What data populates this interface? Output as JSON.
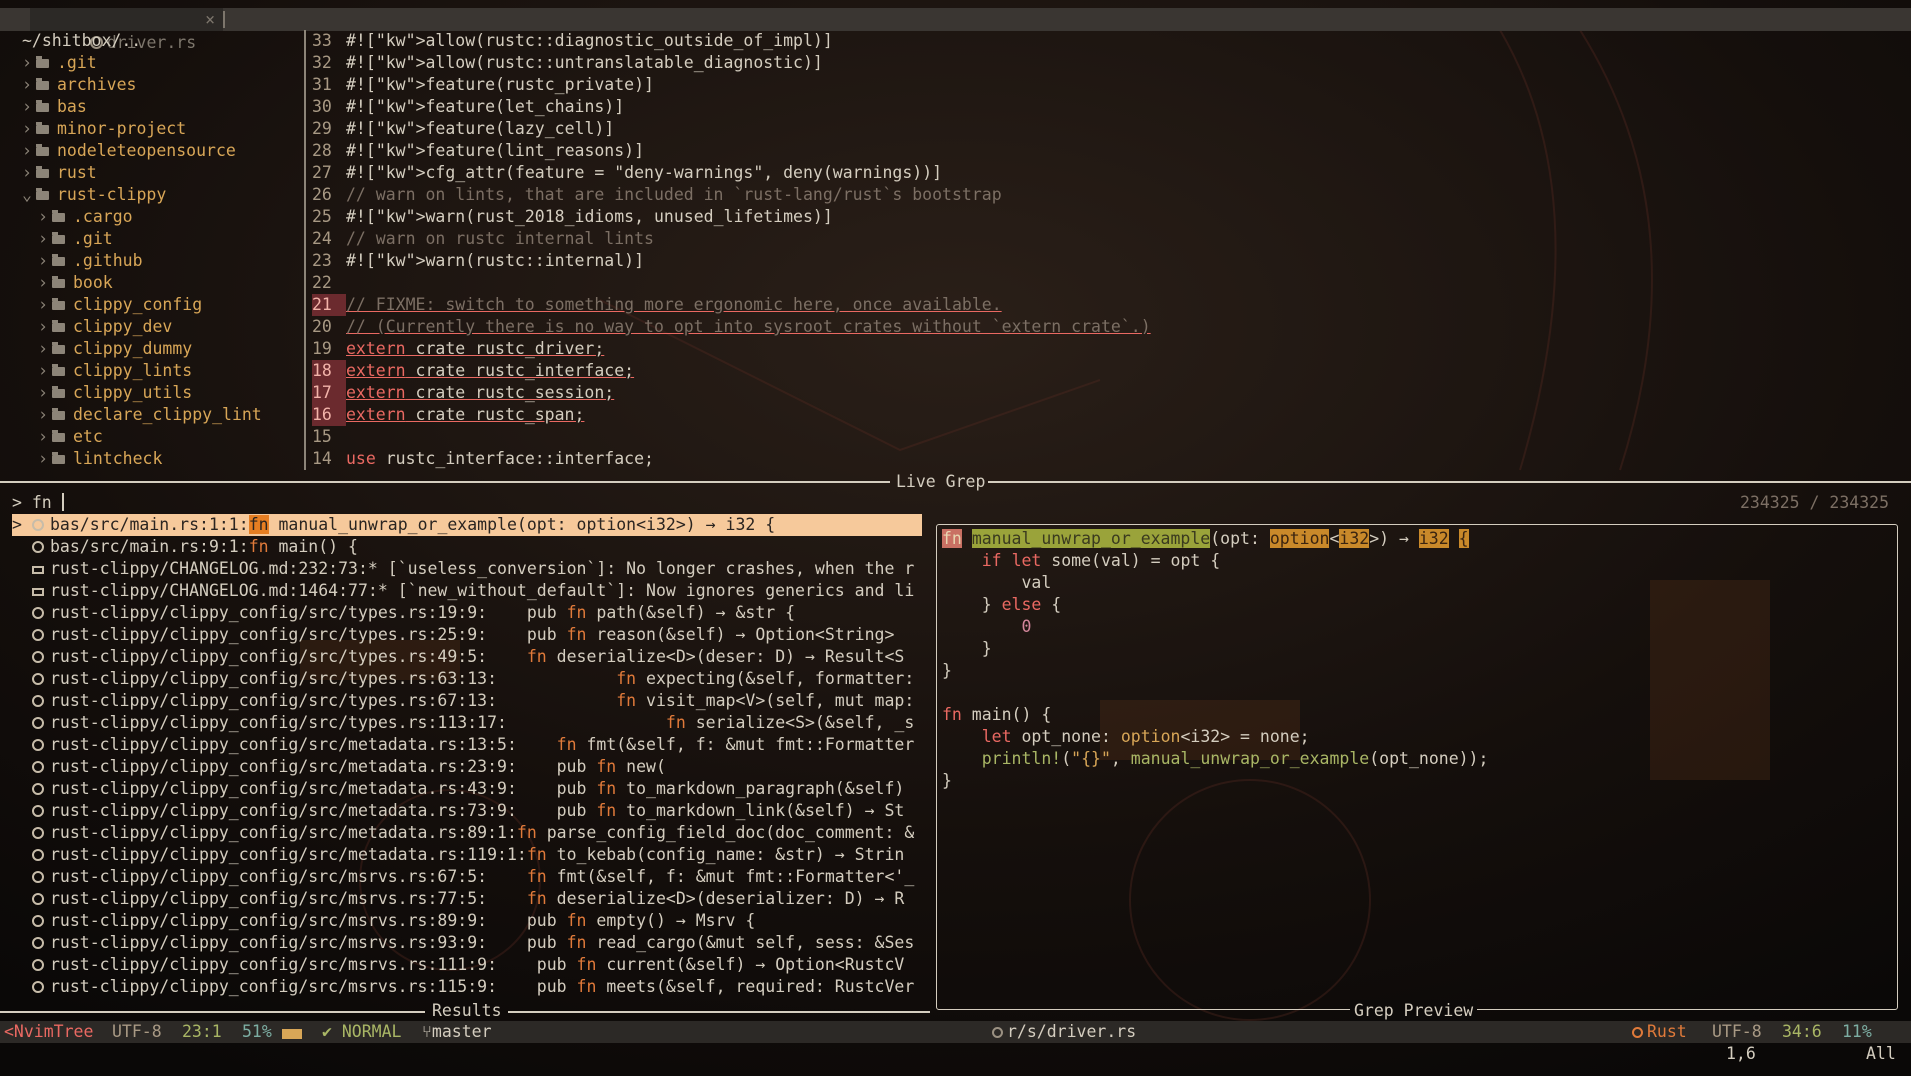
{
  "tab": {
    "filename": "driver.rs",
    "close": "×"
  },
  "tree": {
    "root": "~/shitbox/..",
    "items": [
      {
        "label": ".git",
        "depth": 1,
        "open": false
      },
      {
        "label": "archives",
        "depth": 1,
        "open": false
      },
      {
        "label": "bas",
        "depth": 1,
        "open": false
      },
      {
        "label": "minor-project",
        "depth": 1,
        "open": false
      },
      {
        "label": "nodeleteopensource",
        "depth": 1,
        "open": false
      },
      {
        "label": "rust",
        "depth": 1,
        "open": false
      },
      {
        "label": "rust-clippy",
        "depth": 1,
        "open": true
      },
      {
        "label": ".cargo",
        "depth": 2,
        "open": false
      },
      {
        "label": ".git",
        "depth": 2,
        "open": false
      },
      {
        "label": ".github",
        "depth": 2,
        "open": false
      },
      {
        "label": "book",
        "depth": 2,
        "open": false
      },
      {
        "label": "clippy_config",
        "depth": 2,
        "open": false
      },
      {
        "label": "clippy_dev",
        "depth": 2,
        "open": false
      },
      {
        "label": "clippy_dummy",
        "depth": 2,
        "open": false
      },
      {
        "label": "clippy_lints",
        "depth": 2,
        "open": false
      },
      {
        "label": "clippy_utils",
        "depth": 2,
        "open": false
      },
      {
        "label": "declare_clippy_lint",
        "depth": 2,
        "open": false
      },
      {
        "label": "etc",
        "depth": 2,
        "open": false
      },
      {
        "label": "lintcheck",
        "depth": 2,
        "open": false
      }
    ]
  },
  "code": [
    {
      "ln": "33",
      "text": "#![allow(rustc::diagnostic_outside_of_impl)]"
    },
    {
      "ln": "32",
      "text": "#![allow(rustc::untranslatable_diagnostic)]"
    },
    {
      "ln": "31",
      "text": "#![feature(rustc_private)]"
    },
    {
      "ln": "30",
      "text": "#![feature(let_chains)]"
    },
    {
      "ln": "29",
      "text": "#![feature(lazy_cell)]"
    },
    {
      "ln": "28",
      "text": "#![feature(lint_reasons)]"
    },
    {
      "ln": "27",
      "text": "#![cfg_attr(feature = \"deny-warnings\", deny(warnings))]"
    },
    {
      "ln": "26",
      "text": "// warn on lints, that are included in `rust-lang/rust`s bootstrap"
    },
    {
      "ln": "25",
      "text": "#![warn(rust_2018_idioms, unused_lifetimes)]"
    },
    {
      "ln": "24",
      "text": "// warn on rustc internal lints"
    },
    {
      "ln": "23",
      "text": "#![warn(rustc::internal)]"
    },
    {
      "ln": "22",
      "text": ""
    },
    {
      "ln": "21",
      "text": "// FIXME: switch to something more ergonomic here, once available."
    },
    {
      "ln": "20",
      "text": "// (Currently there is no way to opt into sysroot crates without `extern crate`.)"
    },
    {
      "ln": "19",
      "text": "extern crate rustc_driver;"
    },
    {
      "ln": "18",
      "text": "extern crate rustc_interface;"
    },
    {
      "ln": "17",
      "text": "extern crate rustc_session;"
    },
    {
      "ln": "16",
      "text": "extern crate rustc_span;"
    },
    {
      "ln": "15",
      "text": ""
    },
    {
      "ln": "14",
      "text": "use rustc_interface::interface;"
    }
  ],
  "grep": {
    "title": "Live Grep",
    "prompt": "> fn ",
    "count": "234325 / 234325",
    "results_label": "Results",
    "preview_label": "Grep Preview",
    "results": [
      {
        "icon": "rust",
        "path": "bas/src/main.rs:1:1:",
        "pre": "",
        "kw": "fn",
        "post": " manual_unwrap_or_example(opt: option<i32>) → i32 {",
        "selected": true
      },
      {
        "icon": "rust",
        "path": "bas/src/main.rs:9:1:",
        "pre": "",
        "kw": "fn",
        "post": " main() {"
      },
      {
        "icon": "md",
        "path": "rust-clippy/CHANGELOG.md:232:73:",
        "pre": "* [`useless_conversion`]: No longer crashes, when the r",
        "kw": "",
        "post": ""
      },
      {
        "icon": "md",
        "path": "rust-clippy/CHANGELOG.md:1464:77:",
        "pre": "* [`new_without_default`]: Now ignores generics and li",
        "kw": "",
        "post": ""
      },
      {
        "icon": "rust",
        "path": "rust-clippy/clippy_config/src/types.rs:19:9:",
        "pre": "    pub ",
        "kw": "fn",
        "post": " path(&self) → &str {"
      },
      {
        "icon": "rust",
        "path": "rust-clippy/clippy_config/src/types.rs:25:9:",
        "pre": "    pub ",
        "kw": "fn",
        "post": " reason(&self) → Option<String>"
      },
      {
        "icon": "rust",
        "path": "rust-clippy/clippy_config/src/types.rs:49:5:",
        "pre": "    ",
        "kw": "fn",
        "post": " deserialize<D>(deser: D) → Result<S"
      },
      {
        "icon": "rust",
        "path": "rust-clippy/clippy_config/src/types.rs:63:13:",
        "pre": "            ",
        "kw": "fn",
        "post": " expecting(&self, formatter:"
      },
      {
        "icon": "rust",
        "path": "rust-clippy/clippy_config/src/types.rs:67:13:",
        "pre": "            ",
        "kw": "fn",
        "post": " visit_map<V>(self, mut map:"
      },
      {
        "icon": "rust",
        "path": "rust-clippy/clippy_config/src/types.rs:113:17:",
        "pre": "                ",
        "kw": "fn",
        "post": " serialize<S>(&self, _s"
      },
      {
        "icon": "rust",
        "path": "rust-clippy/clippy_config/src/metadata.rs:13:5:",
        "pre": "    ",
        "kw": "fn",
        "post": " fmt(&self, f: &mut fmt::Formatter"
      },
      {
        "icon": "rust",
        "path": "rust-clippy/clippy_config/src/metadata.rs:23:9:",
        "pre": "    pub ",
        "kw": "fn",
        "post": " new("
      },
      {
        "icon": "rust",
        "path": "rust-clippy/clippy_config/src/metadata.rs:43:9:",
        "pre": "    pub ",
        "kw": "fn",
        "post": " to_markdown_paragraph(&self)"
      },
      {
        "icon": "rust",
        "path": "rust-clippy/clippy_config/src/metadata.rs:73:9:",
        "pre": "    pub ",
        "kw": "fn",
        "post": " to_markdown_link(&self) → St"
      },
      {
        "icon": "rust",
        "path": "rust-clippy/clippy_config/src/metadata.rs:89:1:",
        "pre": "",
        "kw": "fn",
        "post": " parse_config_field_doc(doc_comment: &"
      },
      {
        "icon": "rust",
        "path": "rust-clippy/clippy_config/src/metadata.rs:119:1:",
        "pre": "",
        "kw": "fn",
        "post": " to_kebab(config_name: &str) → Strin"
      },
      {
        "icon": "rust",
        "path": "rust-clippy/clippy_config/src/msrvs.rs:67:5:",
        "pre": "    ",
        "kw": "fn",
        "post": " fmt(&self, f: &mut fmt::Formatter<'_"
      },
      {
        "icon": "rust",
        "path": "rust-clippy/clippy_config/src/msrvs.rs:77:5:",
        "pre": "    ",
        "kw": "fn",
        "post": " deserialize<D>(deserializer: D) → R"
      },
      {
        "icon": "rust",
        "path": "rust-clippy/clippy_config/src/msrvs.rs:89:9:",
        "pre": "    pub ",
        "kw": "fn",
        "post": " empty() → Msrv {"
      },
      {
        "icon": "rust",
        "path": "rust-clippy/clippy_config/src/msrvs.rs:93:9:",
        "pre": "    pub ",
        "kw": "fn",
        "post": " read_cargo(&mut self, sess: &Ses"
      },
      {
        "icon": "rust",
        "path": "rust-clippy/clippy_config/src/msrvs.rs:111:9:",
        "pre": "    pub ",
        "kw": "fn",
        "post": " current(&self) → Option<RustcV"
      },
      {
        "icon": "rust",
        "path": "rust-clippy/clippy_config/src/msrvs.rs:115:9:",
        "pre": "    pub ",
        "kw": "fn",
        "post": " meets(&self, required: RustcVer"
      }
    ],
    "preview": [
      "fn manual_unwrap_or_example(opt: option<i32>) → i32 {",
      "    if let some(val) = opt {",
      "        val",
      "    } else {",
      "        0",
      "    }",
      "}",
      "",
      "fn main() {",
      "    let opt_none: option<i32> = none;",
      "    println!(\"{}\", manual_unwrap_or_example(opt_none));",
      "}"
    ]
  },
  "status": {
    "tree_name": "<NvimTree",
    "tree_enc": "UTF-8",
    "tree_pos": "23:1",
    "tree_pct": "51%",
    "mode": "NORMAL",
    "branch": "master",
    "file": "r/s/driver.rs",
    "lang": "Rust",
    "enc": "UTF-8",
    "pos": "34:6",
    "pct": "11%"
  },
  "cmdline": {
    "pos": "1,6",
    "all": "All"
  },
  "colors": {
    "accent": "#d8a657",
    "keyword": "#e07a3a",
    "mode": "#a9b665",
    "tree_name": "#ea6962",
    "selection": "#f6c99b"
  }
}
